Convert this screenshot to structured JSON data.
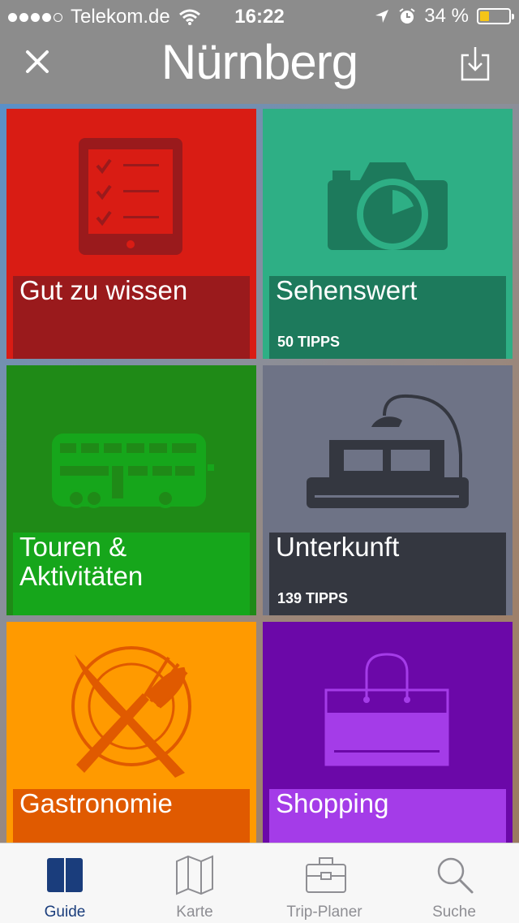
{
  "status_bar": {
    "carrier": "Telekom.de",
    "time": "16:22",
    "battery": "34 %",
    "battery_level": 0.34
  },
  "nav": {
    "title": "Nürnberg",
    "close_icon": "close-icon",
    "download_icon": "download-icon"
  },
  "tiles": [
    {
      "title": "Gut zu wissen",
      "count": "",
      "color": "#d91c14",
      "label_color": "#9a1a1c",
      "icon": "checklist-tablet-icon"
    },
    {
      "title": "Sehenswert",
      "count": "50 TIPPS",
      "color": "#2eaf85",
      "label_color": "#1d7a5c",
      "icon": "camera-icon"
    },
    {
      "title": "Touren &\nAktivitäten",
      "count": "",
      "color": "#1f8a17",
      "label_color": "#16a61b",
      "icon": "bus-icon"
    },
    {
      "title": "Unterkunft",
      "count": "139 TIPPS",
      "color": "#6e7386",
      "label_color": "#343740",
      "icon": "bed-icon"
    },
    {
      "title": "Gastronomie",
      "count": "",
      "color": "#ff9a00",
      "label_color": "#e05a00",
      "icon": "cutlery-icon"
    },
    {
      "title": "Shopping",
      "count": "",
      "color": "#6b08a8",
      "label_color": "#a43ce8",
      "icon": "shopping-bag-icon"
    }
  ],
  "tabs": [
    {
      "label": "Guide",
      "icon": "book-icon",
      "active": true
    },
    {
      "label": "Karte",
      "icon": "map-icon",
      "active": false
    },
    {
      "label": "Trip-Planer",
      "icon": "briefcase-icon",
      "active": false
    },
    {
      "label": "Suche",
      "icon": "search-icon",
      "active": false
    }
  ]
}
